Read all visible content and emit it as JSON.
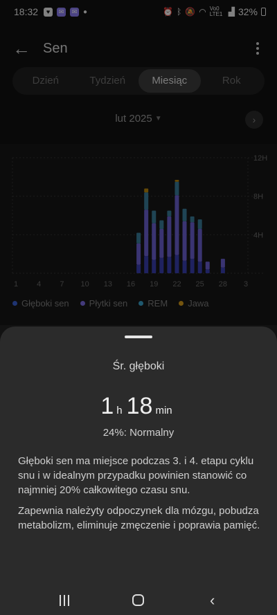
{
  "status": {
    "time": "18:32",
    "network": "Vo0 LTE1",
    "battery": "32%"
  },
  "header": {
    "title": "Sen"
  },
  "tabs": [
    {
      "label": "Dzień",
      "active": false
    },
    {
      "label": "Tydzień",
      "active": false
    },
    {
      "label": "Miesiąc",
      "active": true
    },
    {
      "label": "Rok",
      "active": false
    }
  ],
  "period": {
    "label": "lut 2025"
  },
  "chart_data": {
    "type": "bar",
    "stacked": true,
    "x_tick_labels": [
      "1",
      "4",
      "7",
      "10",
      "13",
      "16",
      "19",
      "22",
      "25",
      "28",
      "3"
    ],
    "y_tick_labels": [
      "12H",
      "8H",
      "4H"
    ],
    "ylim": [
      0,
      12
    ],
    "days": [
      17,
      18,
      19,
      20,
      21,
      22,
      23,
      24,
      25,
      26,
      28
    ],
    "series": [
      {
        "name": "Głęboki sen",
        "color": "#3a3fb0",
        "values": [
          0.9,
          1.8,
          1.4,
          1.6,
          1.7,
          1.9,
          1.3,
          1.5,
          1.2,
          0.4,
          0.6
        ]
      },
      {
        "name": "Płytki sen",
        "color": "#6b5fcf",
        "values": [
          2.2,
          4.8,
          3.8,
          3.0,
          4.2,
          6.2,
          4.1,
          3.8,
          3.4,
          0.8,
          0.9
        ]
      },
      {
        "name": "REM",
        "color": "#3a7d9a",
        "values": [
          1.1,
          1.8,
          1.3,
          0.9,
          0.6,
          1.4,
          1.3,
          0.6,
          1.0,
          0.0,
          0.0
        ]
      },
      {
        "name": "Jawa",
        "color": "#b8860b",
        "values": [
          0.0,
          0.4,
          0.0,
          0.0,
          0.0,
          0.2,
          0.0,
          0.0,
          0.0,
          0.0,
          0.0
        ]
      }
    ]
  },
  "legend": [
    {
      "label": "Głęboki sen",
      "color": "#3a5fd0"
    },
    {
      "label": "Płytki sen",
      "color": "#7b6ae0"
    },
    {
      "label": "REM",
      "color": "#3aa0c8"
    },
    {
      "label": "Jawa",
      "color": "#d39a1a"
    }
  ],
  "sheet": {
    "title": "Śr. głęboki",
    "hours": "1",
    "hours_unit": "h",
    "minutes": "18",
    "minutes_unit": "min",
    "percent": "24%: Normalny",
    "paragraph1": "Głęboki sen ma miejsce podczas 3. i 4. etapu cyklu snu i w idealnym przypadku powinien stanowić co najmniej 20% całkowitego czasu snu.",
    "paragraph2": "Zapewnia należyty odpoczynek dla mózgu, pobudza metabolizm, eliminuje zmęczenie i poprawia pamięć."
  }
}
